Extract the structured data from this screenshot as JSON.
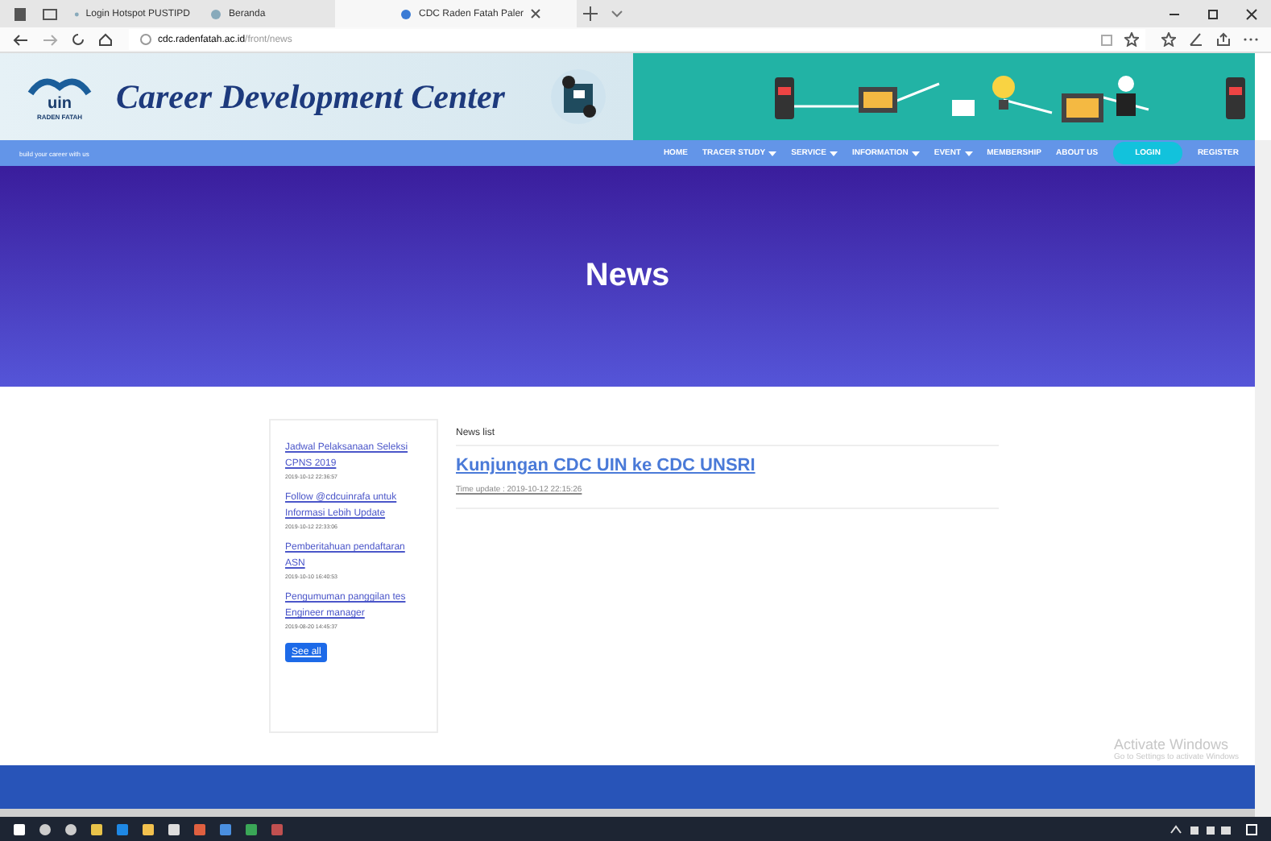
{
  "browser": {
    "tabs": [
      {
        "label": "Login Hotspot PUSTIPD",
        "selected": false
      },
      {
        "label": "Beranda",
        "selected": false
      },
      {
        "label": "CDC Raden Fatah Paler",
        "selected": true
      }
    ],
    "url_host": "cdc.radenfatah.ac.id",
    "url_path": "/front/news"
  },
  "header": {
    "logo_text": "uin",
    "logo_caption": "RADEN FATAH",
    "title": "Career Development Center"
  },
  "navbar": {
    "tagline": "build your career with us",
    "items": [
      {
        "label": "HOME",
        "has_menu": false
      },
      {
        "label": "TRACER STUDY",
        "has_menu": true
      },
      {
        "label": "SERVICE",
        "has_menu": true
      },
      {
        "label": "INFORMATION",
        "has_menu": true
      },
      {
        "label": "EVENT",
        "has_menu": true
      },
      {
        "label": "MEMBERSHIP",
        "has_menu": false
      },
      {
        "label": "ABOUT US",
        "has_menu": false
      },
      {
        "label": "LOGIN",
        "has_menu": false,
        "kind": "pill"
      },
      {
        "label": "REGISTER",
        "has_menu": false
      }
    ]
  },
  "hero": {
    "title": "News"
  },
  "sidebar": {
    "items": [
      {
        "title": "Jadwal Pelaksanaan Seleksi CPNS 2019",
        "date": "2019-10-12 22:36:57"
      },
      {
        "title": "Follow @cdcuinrafa untuk Informasi Lebih Update",
        "date": "2019-10-12 22:33:06"
      },
      {
        "title": "Pemberitahuan pendaftaran ASN",
        "date": "2019-10-10 16:40:53"
      },
      {
        "title": "Pengumuman panggilan tes Engineer manager",
        "date": "2019-08-20 14:45:37"
      }
    ],
    "button": "See all"
  },
  "news": {
    "heading": "News list",
    "items": [
      {
        "title": "Kunjungan CDC UIN ke CDC UNSRI",
        "time": "Time update : 2019-10-12 22:15:26"
      }
    ]
  },
  "activation_notice": {
    "title": "Activate Windows",
    "subtitle": "Go to Settings to activate Windows"
  }
}
